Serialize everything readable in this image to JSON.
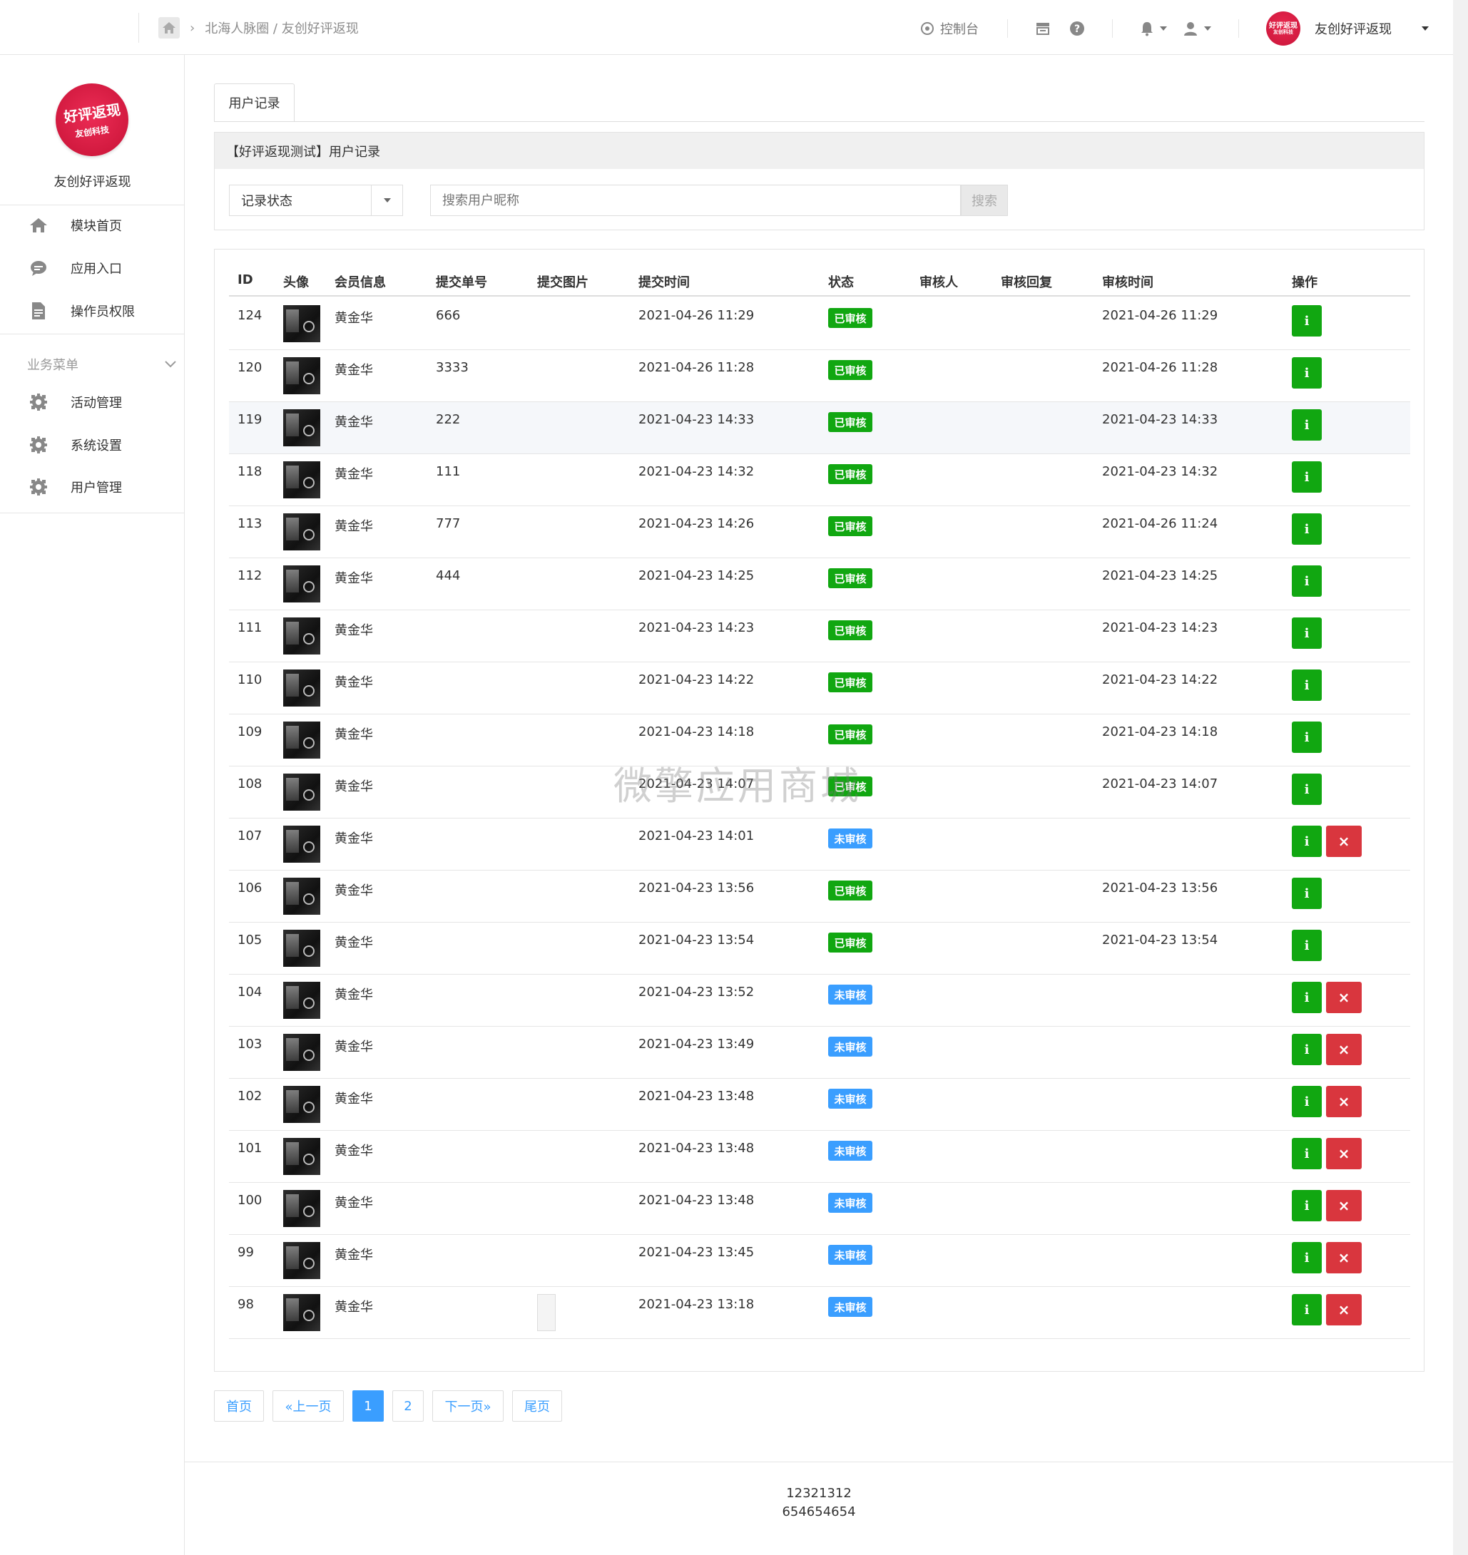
{
  "breadcrumb": {
    "path": "北海人脉圈 / 友创好评返现"
  },
  "topnav": {
    "console": "控制台",
    "account_name": "友创好评返现",
    "logo_line1": "好评返现",
    "logo_line2": "友创科技"
  },
  "sidebar": {
    "logo_line1": "好评返现",
    "logo_line2": "友创科技",
    "title": "友创好评返现",
    "items": [
      {
        "label": "模块首页",
        "icon": "home-icon"
      },
      {
        "label": "应用入口",
        "icon": "chat-icon"
      },
      {
        "label": "操作员权限",
        "icon": "document-icon"
      }
    ],
    "group_label": "业务菜单",
    "group_items": [
      {
        "label": "活动管理",
        "icon": "gear-icon"
      },
      {
        "label": "系统设置",
        "icon": "gear-icon"
      },
      {
        "label": "用户管理",
        "icon": "gear-icon"
      }
    ]
  },
  "tab": {
    "label": "用户记录"
  },
  "panel": {
    "heading": "【好评返现测试】用户记录"
  },
  "filter": {
    "status_select": "记录状态",
    "search_placeholder": "搜索用户昵称",
    "search_button": "搜索"
  },
  "table": {
    "headers": {
      "id": "ID",
      "avatar": "头像",
      "member": "会员信息",
      "order": "提交单号",
      "image": "提交图片",
      "submit_time": "提交时间",
      "status": "状态",
      "reviewer": "审核人",
      "reply": "审核回复",
      "review_time": "审核时间",
      "action": "操作"
    },
    "rows": [
      {
        "id": "124",
        "member": "黄金华",
        "order": "666",
        "submit_time": "2021-04-26 11:29",
        "status": "已审核",
        "review_time": "2021-04-26 11:29"
      },
      {
        "id": "120",
        "member": "黄金华",
        "order": "3333",
        "submit_time": "2021-04-26 11:28",
        "status": "已审核",
        "review_time": "2021-04-26 11:28"
      },
      {
        "id": "119",
        "member": "黄金华",
        "order": "222",
        "submit_time": "2021-04-23 14:33",
        "status": "已审核",
        "review_time": "2021-04-23 14:33"
      },
      {
        "id": "118",
        "member": "黄金华",
        "order": "111",
        "submit_time": "2021-04-23 14:32",
        "status": "已审核",
        "review_time": "2021-04-23 14:32"
      },
      {
        "id": "113",
        "member": "黄金华",
        "order": "777",
        "submit_time": "2021-04-23 14:26",
        "status": "已审核",
        "review_time": "2021-04-26 11:24"
      },
      {
        "id": "112",
        "member": "黄金华",
        "order": "444",
        "submit_time": "2021-04-23 14:25",
        "status": "已审核",
        "review_time": "2021-04-23 14:25"
      },
      {
        "id": "111",
        "member": "黄金华",
        "order": "",
        "submit_time": "2021-04-23 14:23",
        "status": "已审核",
        "review_time": "2021-04-23 14:23"
      },
      {
        "id": "110",
        "member": "黄金华",
        "order": "",
        "submit_time": "2021-04-23 14:22",
        "status": "已审核",
        "review_time": "2021-04-23 14:22"
      },
      {
        "id": "109",
        "member": "黄金华",
        "order": "",
        "submit_time": "2021-04-23 14:18",
        "status": "已审核",
        "review_time": "2021-04-23 14:18"
      },
      {
        "id": "108",
        "member": "黄金华",
        "order": "",
        "submit_time": "2021-04-23 14:07",
        "status": "已审核",
        "review_time": "2021-04-23 14:07"
      },
      {
        "id": "107",
        "member": "黄金华",
        "order": "",
        "submit_time": "2021-04-23 14:01",
        "status": "未审核",
        "review_time": ""
      },
      {
        "id": "106",
        "member": "黄金华",
        "order": "",
        "submit_time": "2021-04-23 13:56",
        "status": "已审核",
        "review_time": "2021-04-23 13:56"
      },
      {
        "id": "105",
        "member": "黄金华",
        "order": "",
        "submit_time": "2021-04-23 13:54",
        "status": "已审核",
        "review_time": "2021-04-23 13:54"
      },
      {
        "id": "104",
        "member": "黄金华",
        "order": "",
        "submit_time": "2021-04-23 13:52",
        "status": "未审核",
        "review_time": ""
      },
      {
        "id": "103",
        "member": "黄金华",
        "order": "",
        "submit_time": "2021-04-23 13:49",
        "status": "未审核",
        "review_time": ""
      },
      {
        "id": "102",
        "member": "黄金华",
        "order": "",
        "submit_time": "2021-04-23 13:48",
        "status": "未审核",
        "review_time": ""
      },
      {
        "id": "101",
        "member": "黄金华",
        "order": "",
        "submit_time": "2021-04-23 13:48",
        "status": "未审核",
        "review_time": ""
      },
      {
        "id": "100",
        "member": "黄金华",
        "order": "",
        "submit_time": "2021-04-23 13:48",
        "status": "未审核",
        "review_time": ""
      },
      {
        "id": "99",
        "member": "黄金华",
        "order": "",
        "submit_time": "2021-04-23 13:45",
        "status": "未审核",
        "review_time": ""
      },
      {
        "id": "98",
        "member": "黄金华",
        "order": "",
        "submit_time": "2021-04-23 13:18",
        "status": "未审核",
        "review_time": "",
        "has_image": true
      }
    ],
    "action_info_label": "i",
    "action_delete_label": "×"
  },
  "pagination": {
    "first": "首页",
    "prev": "«上一页",
    "pages": [
      "1",
      "2"
    ],
    "current": "1",
    "next": "下一页»",
    "last": "尾页"
  },
  "footer": {
    "line1": "12321312",
    "line2": "654654654"
  },
  "watermark": "微擎应用商城",
  "colors": {
    "approved": "#11a711",
    "pending": "#3a9eff",
    "delete": "#d9363e",
    "brand": "#d81e45"
  }
}
